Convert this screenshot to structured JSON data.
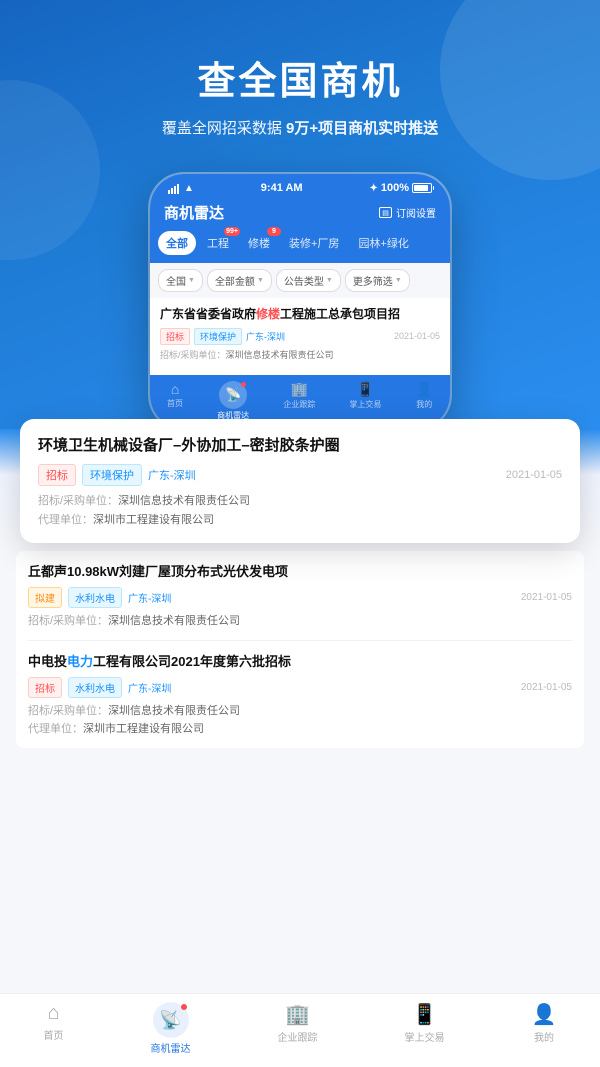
{
  "hero": {
    "title": "查全国商机",
    "subtitle_prefix": "覆盖全网招采数据",
    "subtitle_highlight": " 9万+项目商机实时推送"
  },
  "phone": {
    "status_bar": {
      "time": "9:41 AM",
      "battery_percent": "100%"
    },
    "app_title": "商机雷达",
    "subscribe_label": "订阅设置",
    "categories": [
      {
        "label": "全部",
        "active": true,
        "badge": null
      },
      {
        "label": "工程",
        "active": false,
        "badge": "99+"
      },
      {
        "label": "修楼",
        "active": false,
        "badge": "9"
      },
      {
        "label": "装修+厂房",
        "active": false,
        "badge": null
      },
      {
        "label": "园林+绿化",
        "active": false,
        "badge": null
      }
    ],
    "filters": [
      {
        "label": "全国"
      },
      {
        "label": "全部金额"
      },
      {
        "label": "公告类型"
      },
      {
        "label": "更多筛选"
      }
    ],
    "first_card": {
      "title_prefix": "广东省省委省政府",
      "title_red": "修楼",
      "title_suffix": "工程施工总承包项目招",
      "tags": [
        "招标",
        "环境保护"
      ],
      "location": "广东-深圳",
      "date": "2021-01-05",
      "info": "招标/采购单位：深圳信息技术有限责任公司"
    }
  },
  "popup_card": {
    "title": "环境卫生机械设备厂–外协加工–密封胶条护圈",
    "tags": [
      "招标",
      "环境保护"
    ],
    "location": "广东-深圳",
    "date": "2021-01-05",
    "info1": "招标/采购单位：深圳信息技术有限责任公司",
    "info2": "代理单位：深圳市工程建设有限公司"
  },
  "cards": [
    {
      "title_prefix": "丘都声10.98kW刘建厂屋顶分布式光伏发电项",
      "title_red": "",
      "tags_type": [
        "拟建"
      ],
      "tags_blue": [
        "水利水电"
      ],
      "location": "广东-深圳",
      "date": "2021-01-05",
      "info1": "招标/采购单位：深圳信息技术有限责任公司",
      "info2": null
    },
    {
      "title_prefix": "中电投",
      "title_red": "电力",
      "title_suffix": "工程有限公司2021年度第六批招标",
      "tags_type": [
        "招标"
      ],
      "tags_blue": [
        "水利水电"
      ],
      "location": "广东-深圳",
      "date": "2021-01-05",
      "info1": "招标/采购单位：深圳信息技术有限责任公司",
      "info2": "代理单位：深圳市工程建设有限公司"
    }
  ],
  "bottom_nav": [
    {
      "label": "首页",
      "icon": "⌂",
      "active": false
    },
    {
      "label": "商机雷达",
      "icon": "📡",
      "active": true
    },
    {
      "label": "企业跟踪",
      "icon": "🏢",
      "active": false
    },
    {
      "label": "掌上交易",
      "icon": "📱",
      "active": false
    },
    {
      "label": "我的",
      "icon": "👤",
      "active": false
    }
  ]
}
